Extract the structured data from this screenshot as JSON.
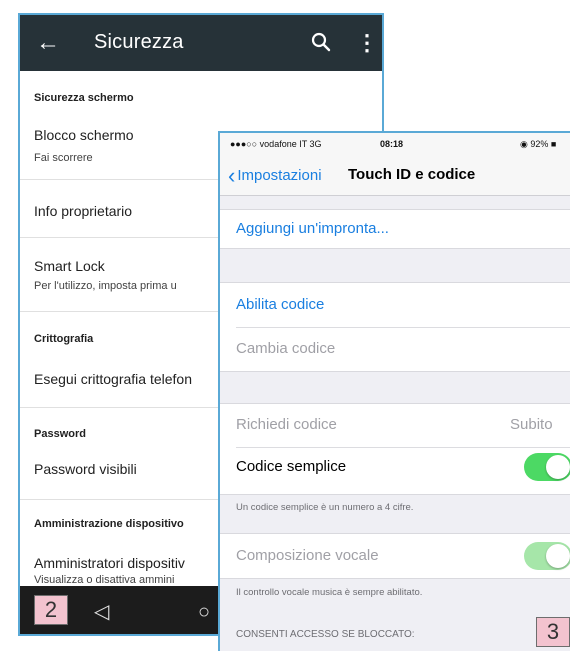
{
  "android": {
    "toolbar": {
      "title": "Sicurezza",
      "back_icon": "arrow-left-icon",
      "search_icon": "search-icon",
      "more_icon": "more-vert-icon"
    },
    "sections": [
      {
        "header": "Sicurezza schermo",
        "items": [
          {
            "title": "Blocco schermo",
            "subtitle": "Fai scorrere"
          },
          {
            "title": "Info proprietario"
          },
          {
            "title": "Smart Lock",
            "subtitle": "Per l'utilizzo, imposta prima u"
          }
        ]
      },
      {
        "header": "Crittografia",
        "items": [
          {
            "title": "Esegui crittografia telefon"
          }
        ]
      },
      {
        "header": "Password",
        "items": [
          {
            "title": "Password visibili"
          }
        ]
      },
      {
        "header": "Amministrazione dispositivo",
        "items": [
          {
            "title": "Amministratori dispositiv",
            "subtitle": "Visualizza o disattiva ammini"
          }
        ]
      }
    ],
    "navbar": {
      "back": "◁",
      "home": "○"
    },
    "badge": "2"
  },
  "ios": {
    "status": {
      "carrier": "●●●○○ vodafone IT  3G",
      "time": "08:18",
      "battery": "◉  92% ■"
    },
    "nav": {
      "back_label": "Impostazioni",
      "title": "Touch ID e codice"
    },
    "rows": {
      "add_fingerprint": "Aggiungi un'impronta...",
      "enable_passcode": "Abilita codice",
      "change_passcode": "Cambia codice",
      "require_passcode": "Richiedi codice",
      "require_value": "Subito",
      "simple_passcode": "Codice semplice",
      "simple_footer": "Un codice semplice è un numero a 4 cifre.",
      "voice_dial": "Composizione vocale",
      "voice_footer": "Il controllo vocale musica è sempre abilitato.",
      "allow_access_header": "CONSENTI ACCESSO SE BLOCCATO:"
    },
    "colors": {
      "link": "#1a7fe0",
      "toggle_on": "#4cd964",
      "toggle_disabled": "#a6e6a9"
    },
    "badge": "3"
  }
}
